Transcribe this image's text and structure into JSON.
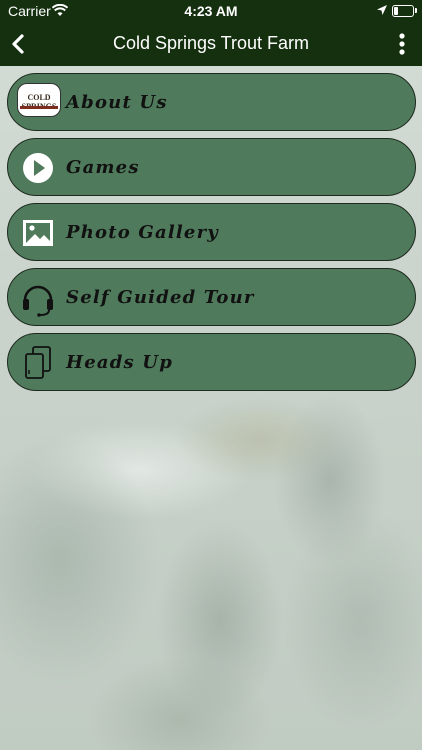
{
  "status_bar": {
    "carrier": "Carrier",
    "time": "4:23 AM",
    "battery_level": 0.25
  },
  "nav": {
    "title": "Cold Springs Trout Farm",
    "back_icon": "chevron-left-icon",
    "more_icon": "more-vertical-icon"
  },
  "menu": {
    "items": [
      {
        "label": "About Us",
        "icon": "cold-springs-logo"
      },
      {
        "label": "Games",
        "icon": "play-circle-icon"
      },
      {
        "label": "Photo Gallery",
        "icon": "image-icon"
      },
      {
        "label": "Self Guided Tour",
        "icon": "headset-icon"
      },
      {
        "label": "Heads Up",
        "icon": "cards-icon"
      }
    ]
  },
  "logo": {
    "text": "COLD SPRINGS"
  },
  "colors": {
    "bar": "#14300f",
    "button": "#4f7a5b",
    "button_border": "#1e2a1f"
  }
}
